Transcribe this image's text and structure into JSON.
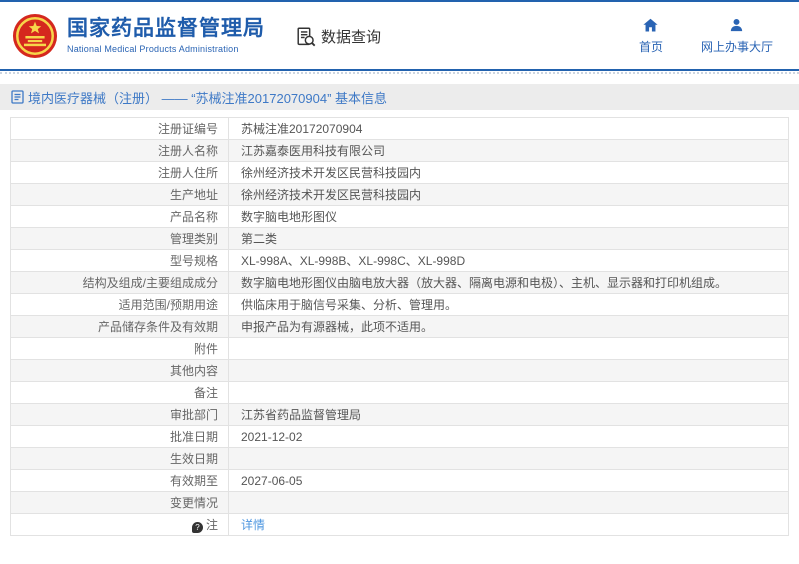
{
  "header": {
    "agency_name_cn": "国家药品监督管理局",
    "agency_name_en": "National Medical Products Administration",
    "section_label": "数据查询",
    "nav_items": [
      {
        "label": "首页",
        "icon": "home-icon"
      },
      {
        "label": "网上办事大厅",
        "icon": "user-icon"
      }
    ]
  },
  "breadcrumb": {
    "icon": "document-icon",
    "text": "境内医疗器械（注册） —— “苏械注准20172070904” 基本信息"
  },
  "table": {
    "rows": [
      {
        "label": "注册证编号",
        "value": "苏械注准20172070904"
      },
      {
        "label": "注册人名称",
        "value": "江苏嘉泰医用科技有限公司"
      },
      {
        "label": "注册人住所",
        "value": "徐州经济技术开发区民营科技园内"
      },
      {
        "label": "生产地址",
        "value": "徐州经济技术开发区民营科技园内"
      },
      {
        "label": "产品名称",
        "value": "数字脑电地形图仪"
      },
      {
        "label": "管理类别",
        "value": "第二类"
      },
      {
        "label": "型号规格",
        "value": "XL-998A、XL-998B、XL-998C、XL-998D"
      },
      {
        "label": "结构及组成/主要组成成分",
        "value": "数字脑电地形图仪由脑电放大器（放大器、隔离电源和电极）、主机、显示器和打印机组成。"
      },
      {
        "label": "适用范围/预期用途",
        "value": "供临床用于脑信号采集、分析、管理用。"
      },
      {
        "label": "产品储存条件及有效期",
        "value": "申报产品为有源器械，此项不适用。"
      },
      {
        "label": "附件",
        "value": ""
      },
      {
        "label": "其他内容",
        "value": ""
      },
      {
        "label": "备注",
        "value": ""
      },
      {
        "label": "审批部门",
        "value": "江苏省药品监督管理局"
      },
      {
        "label": "批准日期",
        "value": "2021-12-02"
      },
      {
        "label": "生效日期",
        "value": ""
      },
      {
        "label": "有效期至",
        "value": "2027-06-05"
      },
      {
        "label": "变更情况",
        "value": ""
      },
      {
        "label": "注",
        "value": "详情",
        "icon": "note-icon",
        "link": true
      }
    ]
  },
  "colors": {
    "brand_blue": "#1f5cab",
    "nav_blue": "#2a64b4",
    "link_blue": "#4f97e0",
    "topbar_blue": "#2262ae",
    "breadcrumb_bg": "#ececec",
    "row_alt_bg": "#f5f5f5",
    "border_gray": "#e2e2e2",
    "emblem_red": "#d5281e",
    "emblem_gold": "#f7d64a"
  }
}
